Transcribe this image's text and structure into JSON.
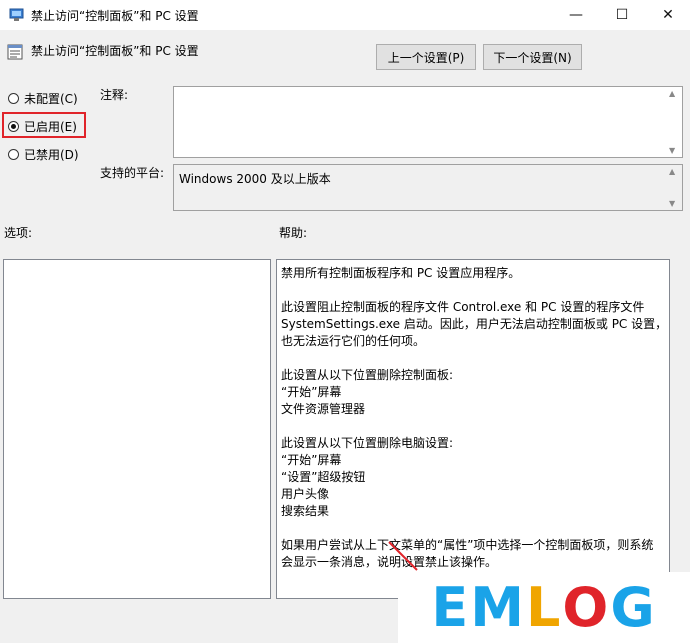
{
  "window": {
    "title": "禁止访问“控制面板”和 PC 设置",
    "minimize_glyph": "—",
    "maximize_glyph": "☐",
    "close_glyph": "✕"
  },
  "header": {
    "setting_name": "禁止访问“控制面板”和 PC 设置",
    "prev_button": "上一个设置(P)",
    "next_button": "下一个设置(N)"
  },
  "state": {
    "options": [
      {
        "label": "未配置(C)",
        "selected": false
      },
      {
        "label": "已启用(E)",
        "selected": true
      },
      {
        "label": "已禁用(D)",
        "selected": false
      }
    ],
    "highlight_color": "#e0242a"
  },
  "comment": {
    "label": "注释:",
    "value": ""
  },
  "platform": {
    "label": "支持的平台:",
    "value": "Windows 2000 及以上版本"
  },
  "options_panel": {
    "label": "选项:"
  },
  "help_panel": {
    "label": "帮助:",
    "lines": [
      "禁用所有控制面板程序和 PC 设置应用程序。",
      "",
      "此设置阻止控制面板的程序文件 Control.exe 和 PC 设置的程序文件",
      "SystemSettings.exe 启动。因此，用户无法启动控制面板或 PC 设置，",
      "也无法运行它们的任何项。",
      "",
      "此设置从以下位置删除控制面板:",
      "“开始”屏幕",
      "文件资源管理器",
      "",
      "此设置从以下位置删除电脑设置:",
      "“开始”屏幕",
      "“设置”超级按钮",
      "用户头像",
      "搜索结果",
      "",
      "如果用户尝试从上下文菜单的“属性”项中选择一个控制面板项，则系统",
      "会显示一条消息，说明设置禁止该操作。"
    ]
  },
  "watermark": {
    "letters": [
      "E",
      "M",
      "L",
      "O",
      "G"
    ],
    "colors": [
      "#1aa3e8",
      "#1aa3e8",
      "#f0a500",
      "#e0242a",
      "#1aa3e8"
    ]
  }
}
